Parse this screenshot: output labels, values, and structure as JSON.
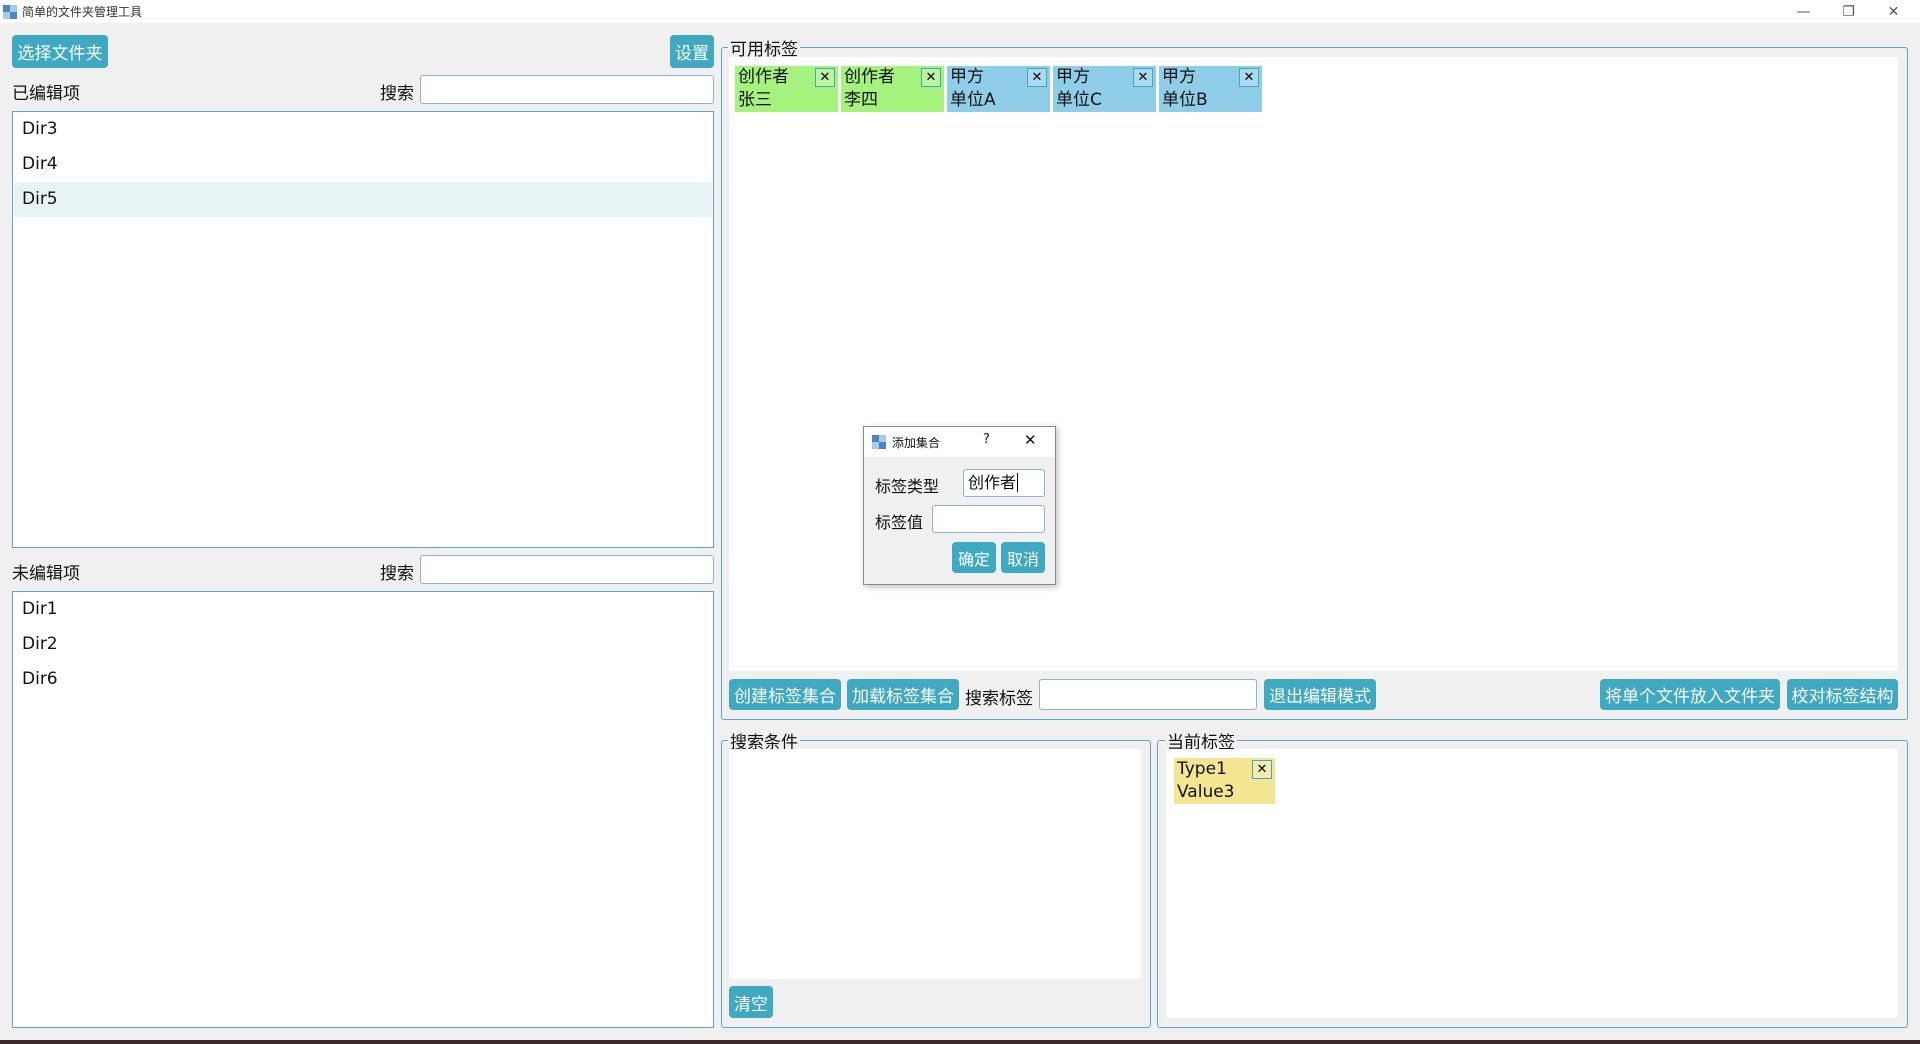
{
  "window": {
    "title": "简单的文件夹管理工具",
    "minimize": "—",
    "restore": "❐",
    "close": "✕"
  },
  "left": {
    "select_folder_label": "选择文件夹",
    "settings_label": "设置",
    "edited": {
      "title": "已编辑项",
      "search_label": "搜索",
      "search_value": "",
      "items": [
        "Dir3",
        "Dir4",
        "Dir5"
      ],
      "selected": "Dir5"
    },
    "unedited": {
      "title": "未编辑项",
      "search_label": "搜索",
      "search_value": "",
      "items": [
        "Dir1",
        "Dir2",
        "Dir6"
      ]
    }
  },
  "available_tags": {
    "title": "可用标签",
    "tags": [
      {
        "type": "创作者",
        "value": "张三",
        "color": "#a6f27e"
      },
      {
        "type": "创作者",
        "value": "李四",
        "color": "#a6f27e"
      },
      {
        "type": "甲方",
        "value": "单位A",
        "color": "#8fcde8"
      },
      {
        "type": "甲方",
        "value": "单位C",
        "color": "#8fcde8"
      },
      {
        "type": "甲方",
        "value": "单位B",
        "color": "#8fcde8"
      }
    ],
    "remove_glyph": "✕"
  },
  "toolbar": {
    "create_set": "创建标签集合",
    "load_set": "加载标签集合",
    "search_tag_label": "搜索标签",
    "search_tag_value": "",
    "exit_edit": "退出编辑模式",
    "put_file": "将单个文件放入文件夹",
    "verify": "校对标签结构"
  },
  "search_conditions": {
    "title": "搜索条件",
    "clear_label": "清空"
  },
  "current_tags": {
    "title": "当前标签",
    "tags": [
      {
        "type": "Type1",
        "value": "Value3",
        "color": "#f3e591"
      }
    ]
  },
  "dialog": {
    "title": "添加集合",
    "help": "?",
    "close": "✕",
    "tag_type_label": "标签类型",
    "tag_type_value": "创作者",
    "tag_value_label": "标签值",
    "tag_value_value": "",
    "ok": "确定",
    "cancel": "取消"
  },
  "colors": {
    "accent": "#3ea9c1",
    "border": "#5fa8c4"
  }
}
